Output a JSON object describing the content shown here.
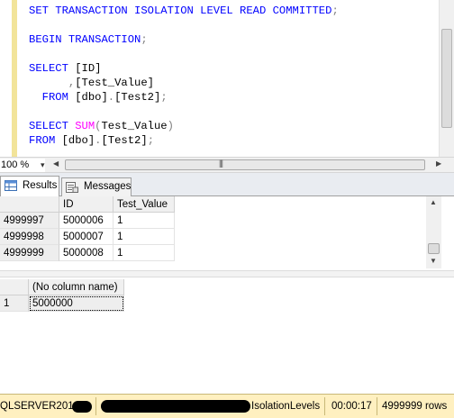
{
  "editor": {
    "lines": [
      {
        "id": "l1",
        "segments": [
          {
            "t": "SET TRANSACTION ISOLATION LEVEL READ COMMITTED",
            "c": "kw"
          },
          {
            "t": ";",
            "c": "gr"
          }
        ]
      },
      {
        "id": "l2",
        "segments": []
      },
      {
        "id": "l3",
        "segments": [
          {
            "t": "BEGIN TRANSACTION",
            "c": "kw"
          },
          {
            "t": ";",
            "c": "gr"
          }
        ]
      },
      {
        "id": "l4",
        "segments": []
      },
      {
        "id": "l5",
        "segments": [
          {
            "t": "SELECT ",
            "c": "kw"
          },
          {
            "t": "[ID]",
            "c": "tx"
          }
        ]
      },
      {
        "id": "l6",
        "segments": [
          {
            "t": "      ",
            "c": "tx"
          },
          {
            "t": ",",
            "c": "gr"
          },
          {
            "t": "[Test_Value]",
            "c": "tx"
          }
        ]
      },
      {
        "id": "l7",
        "segments": [
          {
            "t": "  FROM ",
            "c": "kw"
          },
          {
            "t": "[dbo]",
            "c": "tx"
          },
          {
            "t": ".",
            "c": "gr"
          },
          {
            "t": "[Test2]",
            "c": "tx"
          },
          {
            "t": ";",
            "c": "gr"
          }
        ]
      },
      {
        "id": "l8",
        "segments": []
      },
      {
        "id": "l9",
        "segments": [
          {
            "t": "SELECT ",
            "c": "kw"
          },
          {
            "t": "SUM",
            "c": "fn"
          },
          {
            "t": "(",
            "c": "gr"
          },
          {
            "t": "Test_Value",
            "c": "tx"
          },
          {
            "t": ")",
            "c": "gr"
          }
        ]
      },
      {
        "id": "l10",
        "segments": [
          {
            "t": "FROM ",
            "c": "kw"
          },
          {
            "t": "[dbo]",
            "c": "tx"
          },
          {
            "t": ".",
            "c": "gr"
          },
          {
            "t": "[Test2]",
            "c": "tx"
          },
          {
            "t": ";",
            "c": "gr"
          }
        ]
      }
    ]
  },
  "zoom": {
    "value": "100 %"
  },
  "hscroll": {
    "grip": "|||"
  },
  "tabs": {
    "results": "Results",
    "messages": "Messages"
  },
  "grid1": {
    "columns": [
      "ID",
      "Test_Value"
    ],
    "rows": [
      {
        "rownum": "4999997",
        "id": "5000006",
        "value": "1"
      },
      {
        "rownum": "4999998",
        "id": "5000007",
        "value": "1"
      },
      {
        "rownum": "4999999",
        "id": "5000008",
        "value": "1"
      }
    ]
  },
  "grid2": {
    "column": "(No column name)",
    "rownum": "1",
    "value": "5000000"
  },
  "status": {
    "server": "QLSERVER2012",
    "database": "IsolationLevels",
    "elapsed": "00:00:17",
    "rows": "4999999 rows"
  },
  "colors": {
    "keyword": "#0000ff",
    "function": "#ff00ff",
    "punct": "#808080",
    "statusbar": "#fff0c0"
  }
}
